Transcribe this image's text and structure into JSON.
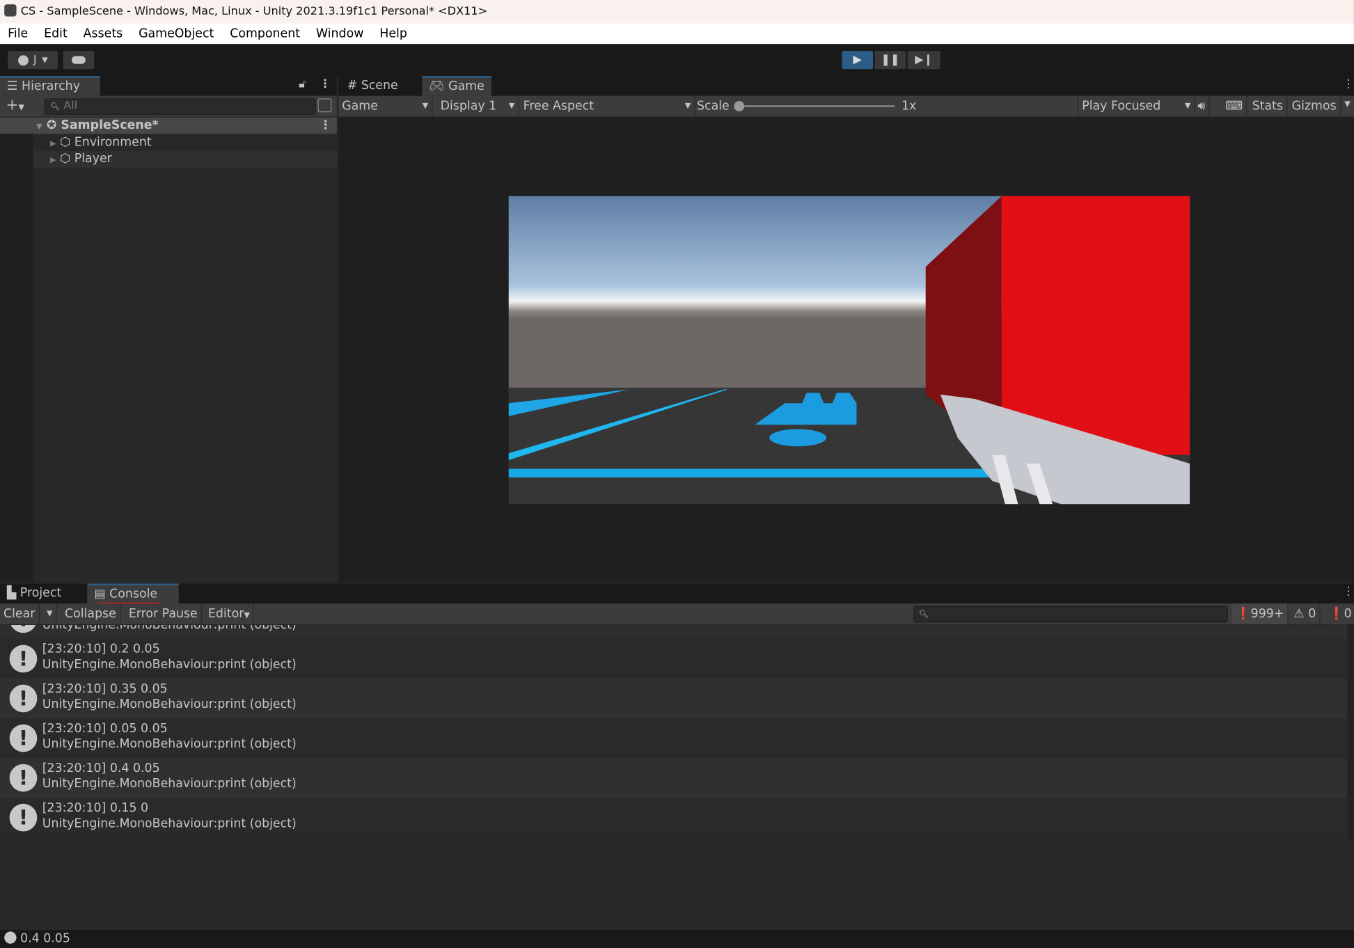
{
  "window": {
    "title": "CS - SampleScene - Windows, Mac, Linux - Unity 2021.3.19f1c1 Personal* <DX11>"
  },
  "menu": [
    "File",
    "Edit",
    "Assets",
    "GameObject",
    "Component",
    "Window",
    "Help"
  ],
  "toolbar": {
    "account": "J"
  },
  "hierarchy": {
    "tab": "Hierarchy",
    "search_placeholder": "All",
    "scene": "SampleScene*",
    "items": [
      "Environment",
      "Player"
    ]
  },
  "game": {
    "tabs": [
      "Scene",
      "Game"
    ],
    "mode": "Game",
    "display": "Display 1",
    "aspect": "Free Aspect",
    "scale_label": "Scale",
    "scale_value": "1x",
    "scale_fraction": 0,
    "play_focused": "Play Focused",
    "stats": "Stats",
    "gizmos": "Gizmos"
  },
  "bottom": {
    "tabs": [
      "Project",
      "Console"
    ],
    "clear": "Clear",
    "collapse": "Collapse",
    "error_pause": "Error Pause",
    "editor": "Editor",
    "log_count": "999+",
    "warn_count": "0",
    "error_count": "0"
  },
  "logs": [
    {
      "l1": "",
      "l2": "UnityEngine.MonoBehaviour:print (object)"
    },
    {
      "l1": "[23:20:10] 0.2 0.05",
      "l2": "UnityEngine.MonoBehaviour:print (object)"
    },
    {
      "l1": "[23:20:10] 0.35 0.05",
      "l2": "UnityEngine.MonoBehaviour:print (object)"
    },
    {
      "l1": "[23:20:10] 0.05 0.05",
      "l2": "UnityEngine.MonoBehaviour:print (object)"
    },
    {
      "l1": "[23:20:10] 0.4 0.05",
      "l2": "UnityEngine.MonoBehaviour:print (object)"
    },
    {
      "l1": "[23:20:10] 0.15 0",
      "l2": "UnityEngine.MonoBehaviour:print (object)"
    }
  ],
  "status": {
    "text": "0.4 0.05"
  },
  "colors": {
    "accent": "#2c5d87",
    "red_annotation": "#e0201e"
  }
}
